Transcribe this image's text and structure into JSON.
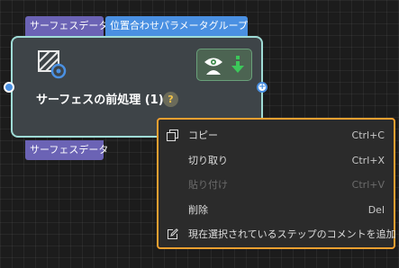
{
  "node": {
    "input_tag": "サーフェスデータ",
    "align_tag": "位置合わせパラメータグループ",
    "output_tag": "サーフェスデータ",
    "title": "サーフェスの前処理 (1)",
    "help": "?",
    "icons": {
      "main": "surface-preprocess-icon",
      "visible": "eye-person-icon",
      "download": "download-arrow-icon"
    }
  },
  "colors": {
    "node_border": "#9fdcd6",
    "menu_border": "#f0a030",
    "tag_purple": "#6b63b5",
    "tag_blue": "#4a90e2"
  },
  "context_menu": {
    "items": [
      {
        "label": "コピー",
        "shortcut": "Ctrl+C",
        "icon": "copy-icon",
        "enabled": true
      },
      {
        "label": "切り取り",
        "shortcut": "Ctrl+X",
        "icon": "",
        "enabled": true
      },
      {
        "label": "貼り付け",
        "shortcut": "Ctrl+V",
        "icon": "",
        "enabled": false
      },
      {
        "label": "削除",
        "shortcut": "Del",
        "icon": "",
        "enabled": true
      },
      {
        "label": "現在選択されているステップのコメントを追加",
        "shortcut": "",
        "icon": "edit-comment-icon",
        "enabled": true
      }
    ]
  }
}
